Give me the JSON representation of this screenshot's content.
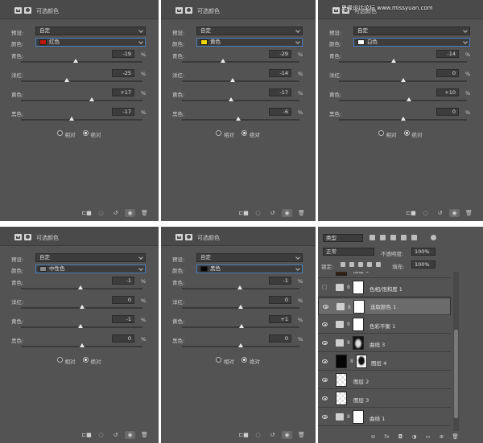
{
  "watermark": "思缘设计论坛 www.missyuan.com",
  "panels": [
    {
      "title": "可选颜色",
      "preset_label": "预设:",
      "preset_value": "自定",
      "color_label": "颜色:",
      "color_value": "红色",
      "swatch": "#c0180c",
      "sliders": [
        {
          "label": "青色:",
          "value": "-19",
          "unit": "%",
          "pos": 0.45
        },
        {
          "label": "洋红:",
          "value": "-25",
          "unit": "%",
          "pos": 0.38
        },
        {
          "label": "黄色:",
          "value": "+17",
          "unit": "%",
          "pos": 0.58
        },
        {
          "label": "黑色:",
          "value": "-17",
          "unit": "%",
          "pos": 0.42
        }
      ],
      "radio_relative": "相对",
      "radio_absolute": "绝对",
      "absolute_selected": true
    },
    {
      "title": "可选颜色",
      "preset_label": "预设:",
      "preset_value": "自定",
      "color_label": "颜色:",
      "color_value": "黄色",
      "swatch": "#f0d800",
      "sliders": [
        {
          "label": "青色:",
          "value": "-29",
          "unit": "%",
          "pos": 0.35
        },
        {
          "label": "洋红:",
          "value": "-14",
          "unit": "%",
          "pos": 0.43
        },
        {
          "label": "黄色:",
          "value": "-17",
          "unit": "%",
          "pos": 0.42
        },
        {
          "label": "黑色:",
          "value": "-6",
          "unit": "%",
          "pos": 0.48
        }
      ],
      "radio_relative": "相对",
      "radio_absolute": "绝对",
      "absolute_selected": true
    },
    {
      "title": "可选颜色",
      "preset_label": "预设:",
      "preset_value": "自定",
      "color_label": "颜色:",
      "color_value": "白色",
      "swatch": "#ffffff",
      "sliders": [
        {
          "label": "青色:",
          "value": "-14",
          "unit": "%",
          "pos": 0.43
        },
        {
          "label": "洋红:",
          "value": "0",
          "unit": "%",
          "pos": 0.5
        },
        {
          "label": "黄色:",
          "value": "+10",
          "unit": "%",
          "pos": 0.55
        },
        {
          "label": "黑色:",
          "value": "0",
          "unit": "%",
          "pos": 0.5
        }
      ],
      "radio_relative": "相对",
      "radio_absolute": "绝对",
      "absolute_selected": true
    },
    {
      "title": "可选颜色",
      "preset_label": "预设:",
      "preset_value": "自定",
      "color_label": "颜色:",
      "color_value": "中性色",
      "swatch": "#8a8a8a",
      "sliders": [
        {
          "label": "青色:",
          "value": "-1",
          "unit": "%",
          "pos": 0.49
        },
        {
          "label": "洋红:",
          "value": "0",
          "unit": "%",
          "pos": 0.5
        },
        {
          "label": "黄色:",
          "value": "-1",
          "unit": "%",
          "pos": 0.49
        },
        {
          "label": "黑色:",
          "value": "0",
          "unit": "%",
          "pos": 0.5
        }
      ],
      "radio_relative": "相对",
      "radio_absolute": "绝对",
      "absolute_selected": true
    },
    {
      "title": "可选颜色",
      "preset_label": "预设:",
      "preset_value": "自定",
      "color_label": "颜色:",
      "color_value": "黑色",
      "swatch": "#050505",
      "sliders": [
        {
          "label": "青色:",
          "value": "-1",
          "unit": "%",
          "pos": 0.49
        },
        {
          "label": "洋红:",
          "value": "0",
          "unit": "%",
          "pos": 0.5
        },
        {
          "label": "黄色:",
          "value": "+1",
          "unit": "%",
          "pos": 0.51
        },
        {
          "label": "黑色:",
          "value": "0",
          "unit": "%",
          "pos": 0.5
        }
      ],
      "radio_relative": "相对",
      "radio_absolute": "绝对",
      "absolute_selected": true
    }
  ],
  "footer_icons": [
    "clip-to-layer-icon",
    "view-previous-icon",
    "reset-icon",
    "visibility-icon",
    "delete-icon"
  ],
  "layers_panel": {
    "filter_label": "类型",
    "blend_mode": "正常",
    "opacity_label": "不透明度:",
    "opacity_value": "100%",
    "lock_label": "锁定:",
    "fill_label": "填充:",
    "fill_value": "100%",
    "layers": [
      {
        "name": "图层 5",
        "visible": true,
        "kind": "pixel",
        "thumb": "photo",
        "selected": false
      },
      {
        "name": "色相/饱和度 1",
        "visible": false,
        "kind": "adjust",
        "thumb": "white",
        "selected": false
      },
      {
        "name": "选取颜色 1",
        "visible": true,
        "kind": "adjust",
        "thumb": "white",
        "selected": true
      },
      {
        "name": "色彩平衡 1",
        "visible": true,
        "kind": "adjust",
        "thumb": "white",
        "selected": false
      },
      {
        "name": "曲线 3",
        "visible": true,
        "kind": "adjust",
        "thumb": "mask",
        "selected": false
      },
      {
        "name": "图层 4",
        "visible": true,
        "kind": "pixel",
        "thumb": "black",
        "selected": false
      },
      {
        "name": "图层 2",
        "visible": true,
        "kind": "pixel",
        "thumb": "checker",
        "selected": false
      },
      {
        "name": "图层 3",
        "visible": true,
        "kind": "pixel",
        "thumb": "checker",
        "selected": false
      },
      {
        "name": "曲线 1",
        "visible": true,
        "kind": "adjust",
        "thumb": "white",
        "selected": false
      }
    ],
    "bottom_icons": [
      "link-icon",
      "fx-icon",
      "mask-icon",
      "adjustment-icon",
      "folder-icon",
      "new-layer-icon",
      "trash-icon"
    ]
  }
}
